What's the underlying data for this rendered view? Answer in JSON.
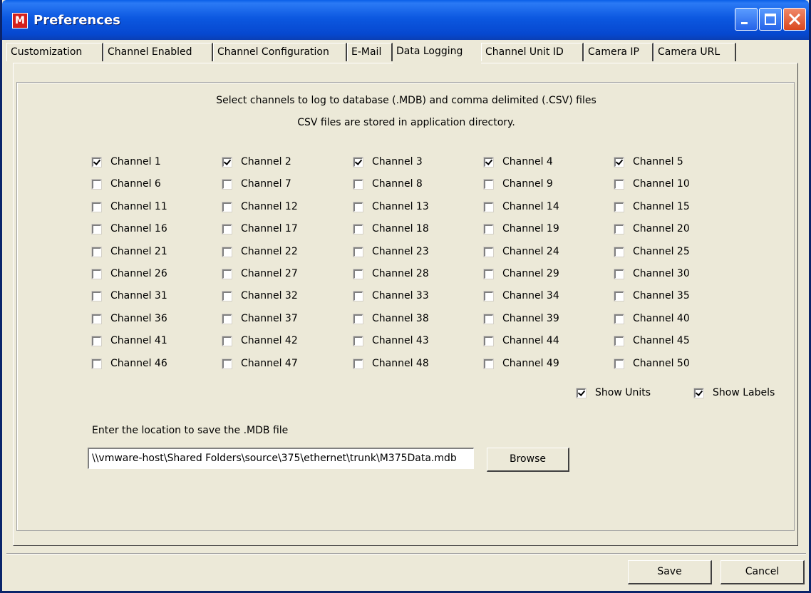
{
  "window": {
    "title": "Preferences",
    "app_icon": "M"
  },
  "tabs": [
    {
      "label": "Customization"
    },
    {
      "label": "Channel Enabled"
    },
    {
      "label": "Channel Configuration"
    },
    {
      "label": "E-Mail"
    },
    {
      "label": "Data Logging"
    },
    {
      "label": "Channel Unit ID"
    },
    {
      "label": "Camera IP"
    },
    {
      "label": "Camera URL"
    }
  ],
  "active_tab": "Data Logging",
  "data_logging": {
    "instruction_line1": "Select channels to log to database (.MDB) and comma delimited (.CSV) files",
    "instruction_line2": "CSV files are stored in application directory.",
    "channels": [
      {
        "label": "Channel 1",
        "checked": true
      },
      {
        "label": "Channel 2",
        "checked": true
      },
      {
        "label": "Channel 3",
        "checked": true
      },
      {
        "label": "Channel 4",
        "checked": true
      },
      {
        "label": "Channel 5",
        "checked": true
      },
      {
        "label": "Channel 6",
        "checked": false
      },
      {
        "label": "Channel 7",
        "checked": false
      },
      {
        "label": "Channel 8",
        "checked": false
      },
      {
        "label": "Channel 9",
        "checked": false
      },
      {
        "label": "Channel 10",
        "checked": false
      },
      {
        "label": "Channel 11",
        "checked": false
      },
      {
        "label": "Channel 12",
        "checked": false
      },
      {
        "label": "Channel 13",
        "checked": false
      },
      {
        "label": "Channel 14",
        "checked": false
      },
      {
        "label": "Channel 15",
        "checked": false
      },
      {
        "label": "Channel 16",
        "checked": false
      },
      {
        "label": "Channel 17",
        "checked": false
      },
      {
        "label": "Channel 18",
        "checked": false
      },
      {
        "label": "Channel 19",
        "checked": false
      },
      {
        "label": "Channel 20",
        "checked": false
      },
      {
        "label": "Channel 21",
        "checked": false
      },
      {
        "label": "Channel 22",
        "checked": false
      },
      {
        "label": "Channel 23",
        "checked": false
      },
      {
        "label": "Channel 24",
        "checked": false
      },
      {
        "label": "Channel 25",
        "checked": false
      },
      {
        "label": "Channel 26",
        "checked": false
      },
      {
        "label": "Channel 27",
        "checked": false
      },
      {
        "label": "Channel 28",
        "checked": false
      },
      {
        "label": "Channel 29",
        "checked": false
      },
      {
        "label": "Channel 30",
        "checked": false
      },
      {
        "label": "Channel 31",
        "checked": false
      },
      {
        "label": "Channel 32",
        "checked": false
      },
      {
        "label": "Channel 33",
        "checked": false
      },
      {
        "label": "Channel 34",
        "checked": false
      },
      {
        "label": "Channel 35",
        "checked": false
      },
      {
        "label": "Channel 36",
        "checked": false
      },
      {
        "label": "Channel 37",
        "checked": false
      },
      {
        "label": "Channel 38",
        "checked": false
      },
      {
        "label": "Channel 39",
        "checked": false
      },
      {
        "label": "Channel 40",
        "checked": false
      },
      {
        "label": "Channel 41",
        "checked": false
      },
      {
        "label": "Channel 42",
        "checked": false
      },
      {
        "label": "Channel 43",
        "checked": false
      },
      {
        "label": "Channel 44",
        "checked": false
      },
      {
        "label": "Channel 45",
        "checked": false
      },
      {
        "label": "Channel 46",
        "checked": false
      },
      {
        "label": "Channel 47",
        "checked": false
      },
      {
        "label": "Channel 48",
        "checked": false
      },
      {
        "label": "Channel 49",
        "checked": false
      },
      {
        "label": "Channel 50",
        "checked": false
      }
    ],
    "show_units": {
      "label": "Show Units",
      "checked": true
    },
    "show_labels": {
      "label": "Show Labels",
      "checked": true
    },
    "location_label": "Enter the location to save the .MDB file",
    "location_value": "\\\\vmware-host\\Shared Folders\\source\\375\\ethernet\\trunk\\M375Data.mdb",
    "browse_label": "Browse"
  },
  "footer": {
    "save_label": "Save",
    "cancel_label": "Cancel"
  },
  "colors": {
    "titlebar": "#0a5fe8",
    "face": "#ece9d8",
    "close_button": "#d9471e"
  }
}
